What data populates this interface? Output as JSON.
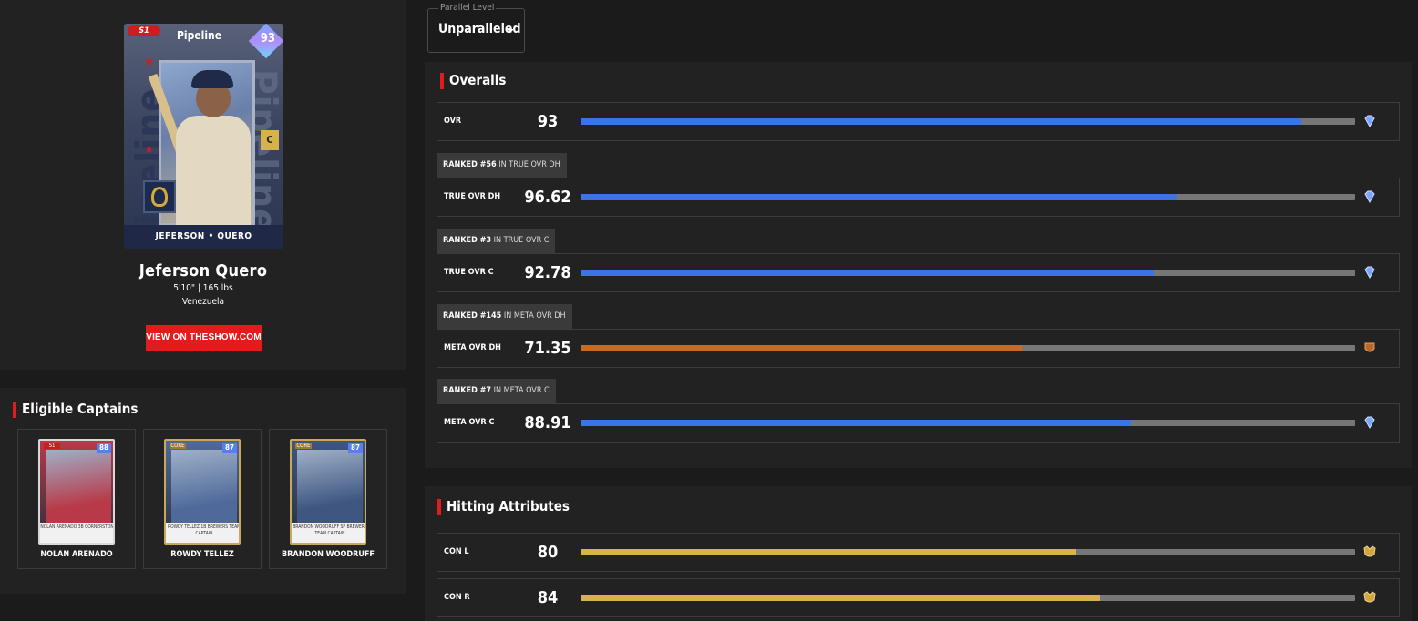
{
  "player": {
    "card": {
      "series": "S1",
      "brand": "Pipeline",
      "ovr": "93",
      "position": "C",
      "name_bar": "JEFERSON • QUERO",
      "side_text": "Pipeline"
    },
    "name": "Jeferson Quero",
    "size": "5'10\" | 165 lbs",
    "country": "Venezuela",
    "theshow_button": "VIEW ON THESHOW.COM"
  },
  "captains": {
    "title": "Eligible Captains",
    "items": [
      {
        "name": "NOLAN ARENADO",
        "ovr": "88",
        "tag": "S1",
        "foot": "NOLAN ARENADO  3B  CORNERSTONE",
        "color": "#b83a48"
      },
      {
        "name": "ROWDY TELLEZ",
        "ovr": "87",
        "tag": "CORE",
        "foot": "ROWDY TELLEZ  1B  BREWERS TEAM CAPTAIN",
        "color": "#4f6a9a"
      },
      {
        "name": "BRANDON WOODRUFF",
        "ovr": "87",
        "tag": "CORE",
        "foot": "BRANDON WOODRUFF  SP  BREWERS TEAM CAPTAIN",
        "color": "#3e5680"
      }
    ]
  },
  "parallel": {
    "label": "Parallel Level",
    "value": "Unparalleled"
  },
  "overalls": {
    "title": "Overalls",
    "rows": [
      {
        "label": "OVR",
        "value": "93",
        "fraction": 0.93,
        "color": "#3b74e6",
        "tier": "diamond-icon",
        "rank": null
      },
      {
        "label": "TRUE OVR DH",
        "value": "96.62",
        "fraction": 0.77,
        "color": "#3b74e6",
        "tier": "diamond-icon",
        "rank": {
          "pre": "RANKED #56",
          "post": " IN TRUE OVR DH"
        }
      },
      {
        "label": "TRUE OVR C",
        "value": "92.78",
        "fraction": 0.74,
        "color": "#3b74e6",
        "tier": "diamond-icon",
        "rank": {
          "pre": "RANKED #3",
          "post": " IN TRUE OVR C"
        }
      },
      {
        "label": "META OVR DH",
        "value": "71.35",
        "fraction": 0.57,
        "color": "#c86a22",
        "tier": "bronze-icon",
        "rank": {
          "pre": "RANKED #145",
          "post": " IN META OVR DH"
        }
      },
      {
        "label": "META OVR C",
        "value": "88.91",
        "fraction": 0.71,
        "color": "#3b74e6",
        "tier": "diamond-icon",
        "rank": {
          "pre": "RANKED #7",
          "post": " IN META OVR C"
        }
      }
    ]
  },
  "hitting": {
    "title": "Hitting Attributes",
    "rows": [
      {
        "label": "CON L",
        "value": "80",
        "fraction": 0.64,
        "color": "#d9b24a",
        "tier": "gold-icon"
      },
      {
        "label": "CON R",
        "value": "84",
        "fraction": 0.67,
        "color": "#d9b24a",
        "tier": "gold-icon"
      }
    ]
  },
  "colors": {
    "accent": "#e11c1c",
    "diamond": "#3b74e6",
    "bronze": "#c86a22",
    "gold": "#d9b24a",
    "track": "#777777"
  }
}
